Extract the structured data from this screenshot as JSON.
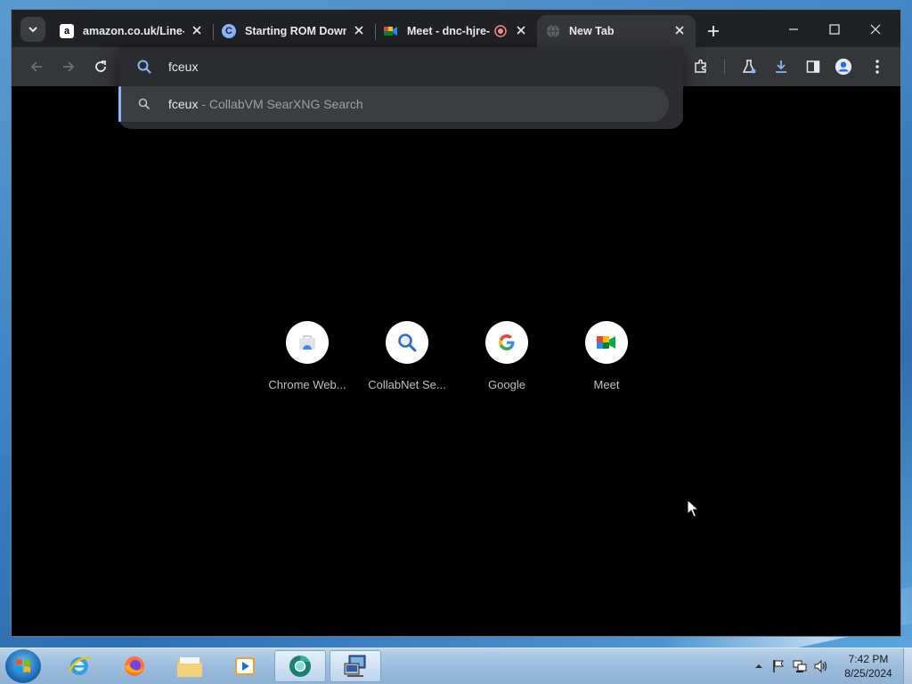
{
  "browser": {
    "tabs": [
      {
        "title": "amazon.co.uk/Line-V",
        "favicon_letter": "a",
        "favicon_icon": "amazon-icon"
      },
      {
        "title": "Starting ROM Down",
        "favicon_letter": "C",
        "favicon_icon": "cloud-icon"
      },
      {
        "title": "Meet - dnc-hjre-",
        "favicon_icon": "meet-icon",
        "recording": true
      },
      {
        "title": "New Tab",
        "favicon_icon": "globe-icon",
        "active": true
      }
    ],
    "omnibox": {
      "value": "fceux",
      "suggestion_query": "fceux",
      "suggestion_source": " - CollabVM SearXNG Search"
    },
    "shortcuts": [
      {
        "label": "Chrome Web...",
        "icon": "chrome-web-store-icon"
      },
      {
        "label": "CollabNet Se...",
        "icon": "magnifier-icon"
      },
      {
        "label": "Google",
        "icon": "google-icon"
      },
      {
        "label": "Meet",
        "icon": "meet-icon"
      }
    ],
    "colors": {
      "accent": "#8ab4f8",
      "frame": "#202124",
      "toolbar": "#35363a",
      "content": "#000000"
    }
  },
  "taskbar": {
    "apps": [
      "internet-explorer-icon",
      "firefox-icon",
      "file-explorer-icon",
      "media-player-icon",
      "chromium-icon",
      "network-app-icon"
    ],
    "clock": {
      "time": "7:42 PM",
      "date": "8/25/2024"
    }
  }
}
